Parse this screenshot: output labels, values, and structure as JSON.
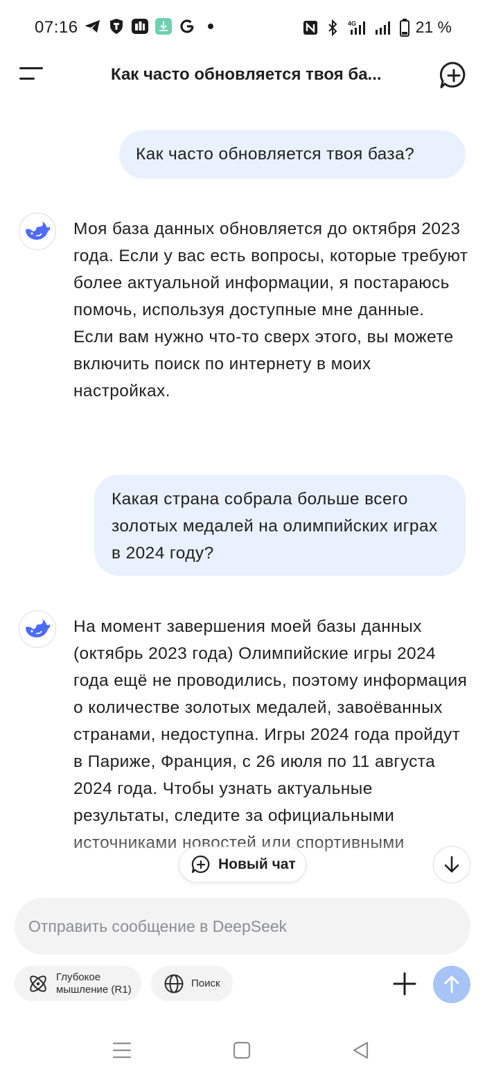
{
  "status_bar": {
    "time": "07:16",
    "battery": "21 %",
    "network": "4G",
    "left_icons": [
      "telegram-icon",
      "shield-app-icon",
      "news-app-icon",
      "download-app-icon",
      "google-icon",
      "dot-icon"
    ],
    "right_icons": [
      "nfc-icon",
      "bluetooth-icon",
      "signal-4g-icon",
      "signal-icon",
      "battery-icon"
    ]
  },
  "header": {
    "title": "Как часто обновляется твоя ба..."
  },
  "messages": [
    {
      "role": "user",
      "text": "Как часто обновляется твоя база?"
    },
    {
      "role": "assistant",
      "text": "Моя база данных обновляется до октября 2023 года. Если у вас есть вопросы, которые требуют более актуальной информации, я постараюсь помочь, используя доступные мне данные. Если вам нужно что-то сверх этого, вы можете включить поиск по интернету в моих настройках."
    },
    {
      "role": "user",
      "text": "Какая страна собрала больше всего золотых медалей на олимпийских играх в 2024 году?"
    },
    {
      "role": "assistant",
      "text": "На момент завершения моей базы данных (октябрь 2023 года) Олимпийские игры 2024 года ещё не проводились, поэтому информация о количестве золотых медалей, завоёванных странами, недоступна. Игры 2024 года пройдут в Париже, Франция, с 26 июля по 11 августа 2024 года. Чтобы узнать актуальные результаты, следите за официальными источниками новостей или спортивными"
    }
  ],
  "floating": {
    "new_chat_label": "Новый чат"
  },
  "composer": {
    "placeholder": "Отправить сообщение в DeepSeek",
    "value": ""
  },
  "chips": {
    "deep_thinking": "Глубокое мышление (R1)",
    "search": "Поиск"
  },
  "colors": {
    "user_bubble": "#e9f1fe",
    "brand_blue": "#4d6bfe",
    "send_disabled": "#a8c4f6",
    "composer_bg": "#f3f3f4"
  }
}
